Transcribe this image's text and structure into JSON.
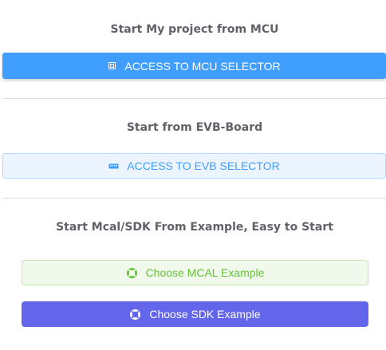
{
  "mcu_section": {
    "title": "Start My project from MCU",
    "button_label": "ACCESS TO MCU SELECTOR",
    "button_icon": "chip-icon"
  },
  "evb_section": {
    "title": "Start from EVB-Board",
    "button_label": "ACCESS TO EVB SELECTOR",
    "button_icon": "board-icon"
  },
  "example_section": {
    "title": "Start Mcal/SDK From Example, Easy to Start",
    "mcal_button_label": "Choose MCAL Example",
    "mcal_button_icon": "lifebuoy-icon",
    "sdk_button_label": "Choose SDK Example",
    "sdk_button_icon": "lifebuoy-icon"
  },
  "colors": {
    "primary": "#409eff",
    "primary_light": "#ecf5ff",
    "success_light": "#f0f9eb",
    "success": "#67c23a",
    "indigo": "#6366ea",
    "title_text": "#5f6368"
  }
}
